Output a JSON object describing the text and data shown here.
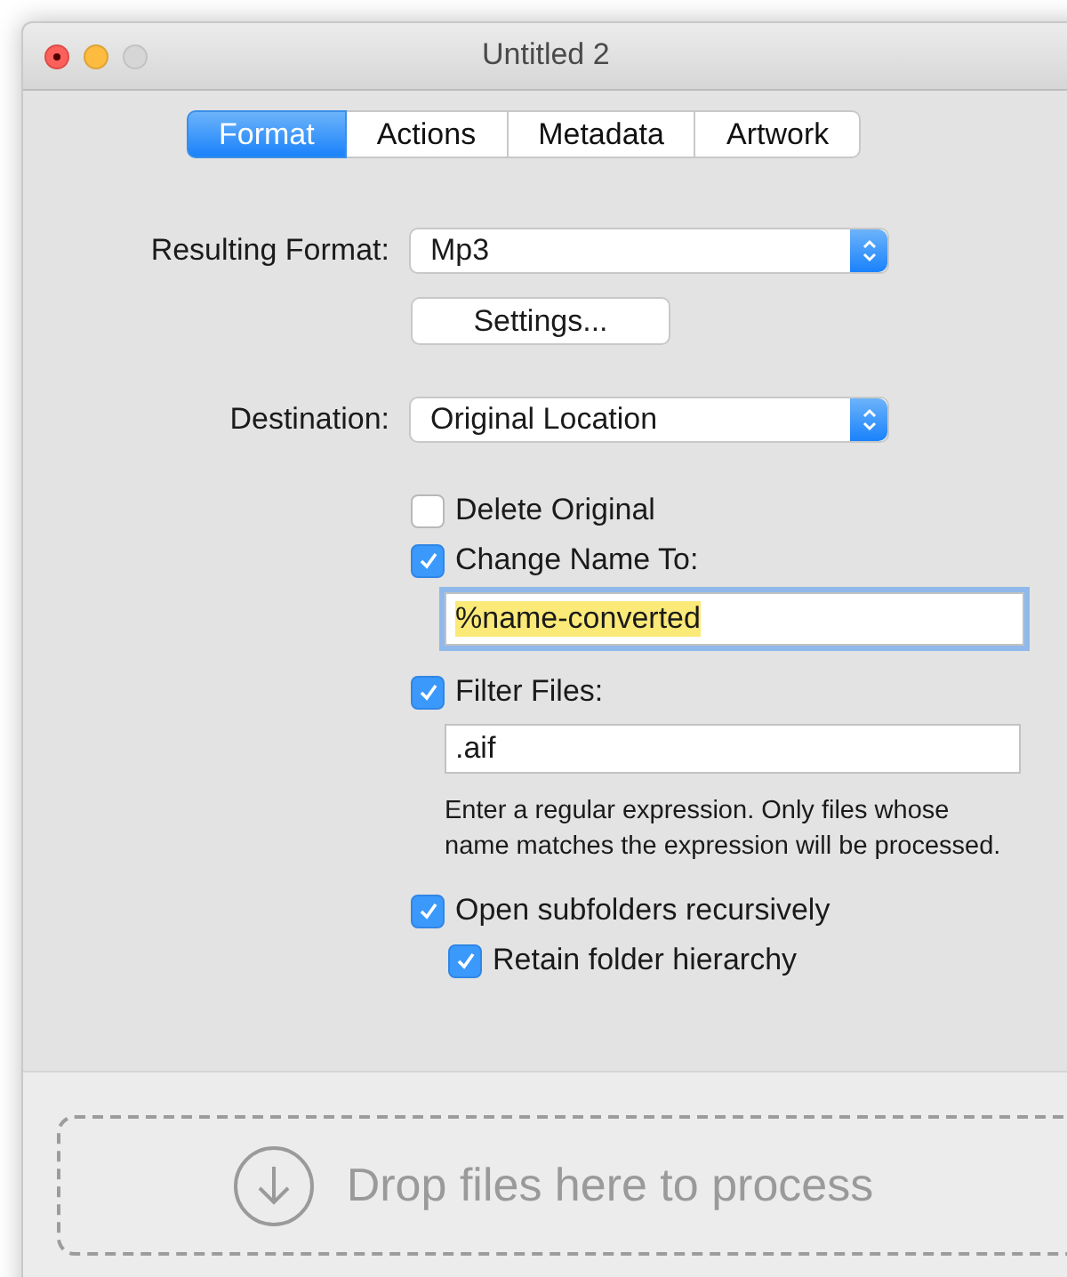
{
  "window": {
    "title": "Untitled 2"
  },
  "tabs": [
    {
      "label": "Format",
      "selected": true
    },
    {
      "label": "Actions",
      "selected": false
    },
    {
      "label": "Metadata",
      "selected": false
    },
    {
      "label": "Artwork",
      "selected": false
    }
  ],
  "resulting_format": {
    "label": "Resulting Format:",
    "value": "Mp3"
  },
  "settings_button": "Settings...",
  "destination": {
    "label": "Destination:",
    "value": "Original Location"
  },
  "delete_original": {
    "label": "Delete Original",
    "checked": false
  },
  "change_name": {
    "label": "Change Name To:",
    "checked": true,
    "value": "%name-converted",
    "highlighted": true,
    "focused": true
  },
  "filter_files": {
    "label": "Filter Files:",
    "checked": true,
    "value": ".aif",
    "help": "Enter a regular expression. Only files whose name matches the expression will be processed."
  },
  "open_subfolders": {
    "label": "Open subfolders recursively",
    "checked": true
  },
  "retain_hierarchy": {
    "label": "Retain folder hierarchy",
    "checked": true
  },
  "drop_zone": {
    "text": "Drop files here to process"
  }
}
